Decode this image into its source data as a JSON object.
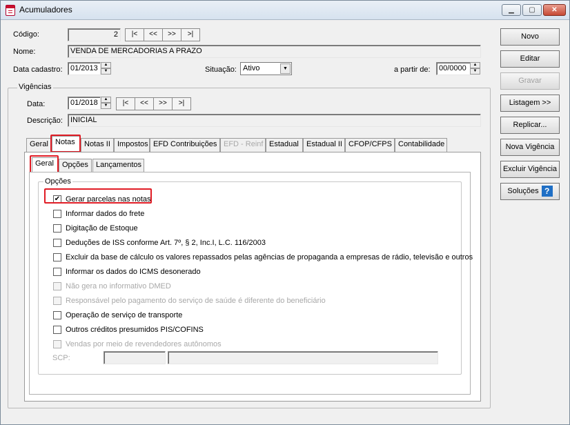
{
  "window": {
    "title": "Acumuladores",
    "min_label": "▭",
    "max_label": "▢",
    "close_label": "✕"
  },
  "form": {
    "codigo_label": "Código:",
    "codigo_value": "2",
    "nav_buttons": [
      "|<",
      "<<",
      ">>",
      ">|"
    ],
    "nome_label": "Nome:",
    "nome_value": "VENDA DE MERCADORIAS A PRAZO",
    "data_cadastro_label": "Data cadastro:",
    "data_cadastro_value": "01/2013",
    "situacao_label": "Situação:",
    "situacao_value": "Ativo",
    "a_partir_label": "a partir de:",
    "a_partir_value": "00/0000"
  },
  "vigencias": {
    "title": "Vigências",
    "data_label": "Data:",
    "data_value": "01/2018",
    "descricao_label": "Descrição:",
    "descricao_value": "INICIAL"
  },
  "tabs": [
    "Geral",
    "Notas",
    "Notas II",
    "Impostos",
    "EFD Contribuições",
    "EFD - Reinf",
    "Estadual",
    "Estadual II",
    "CFOP/CFPS",
    "Contabilidade"
  ],
  "subtabs": [
    "Geral",
    "Opções",
    "Lançamentos"
  ],
  "opcoes": {
    "title": "Opções",
    "items": [
      {
        "label": "Gerar parcelas nas notas",
        "checked": true,
        "enabled": true
      },
      {
        "label": "Informar dados do frete",
        "checked": false,
        "enabled": true
      },
      {
        "label": "Digitação de Estoque",
        "checked": false,
        "enabled": true
      },
      {
        "label": "Deduções de ISS conforme Art. 7º, § 2, Inc.I, L.C. 116/2003",
        "checked": false,
        "enabled": true
      },
      {
        "label": "Excluir da base de cálculo os valores repassados pelas agências de propaganda a empresas de rádio, televisão e outros",
        "checked": false,
        "enabled": true
      },
      {
        "label": "Informar os dados do ICMS desonerado",
        "checked": false,
        "enabled": true
      },
      {
        "label": "Não gera no informativo DMED",
        "checked": false,
        "enabled": false
      },
      {
        "label": "Responsável pelo pagamento do serviço de saúde é diferente do beneficiário",
        "checked": false,
        "enabled": false
      },
      {
        "label": "Operação de serviço de transporte",
        "checked": false,
        "enabled": true
      },
      {
        "label": "Outros créditos presumidos PIS/COFINS",
        "checked": false,
        "enabled": true
      },
      {
        "label": "Vendas por meio de revendedores autônomos",
        "checked": false,
        "enabled": false
      }
    ],
    "scp_label": "SCP:"
  },
  "side_buttons": [
    "Novo",
    "Editar",
    "Gravar",
    "Listagem >>",
    "Replicar...",
    "Nova Vigência",
    "Excluir Vigência",
    "Soluções"
  ],
  "help_glyph": "?",
  "check_glyph": "✔",
  "spin_up": "▲",
  "spin_down": "▼",
  "combo_arrow": "▼",
  "colors": {
    "highlight": "#e01b24",
    "help": "#1f6fc5"
  }
}
